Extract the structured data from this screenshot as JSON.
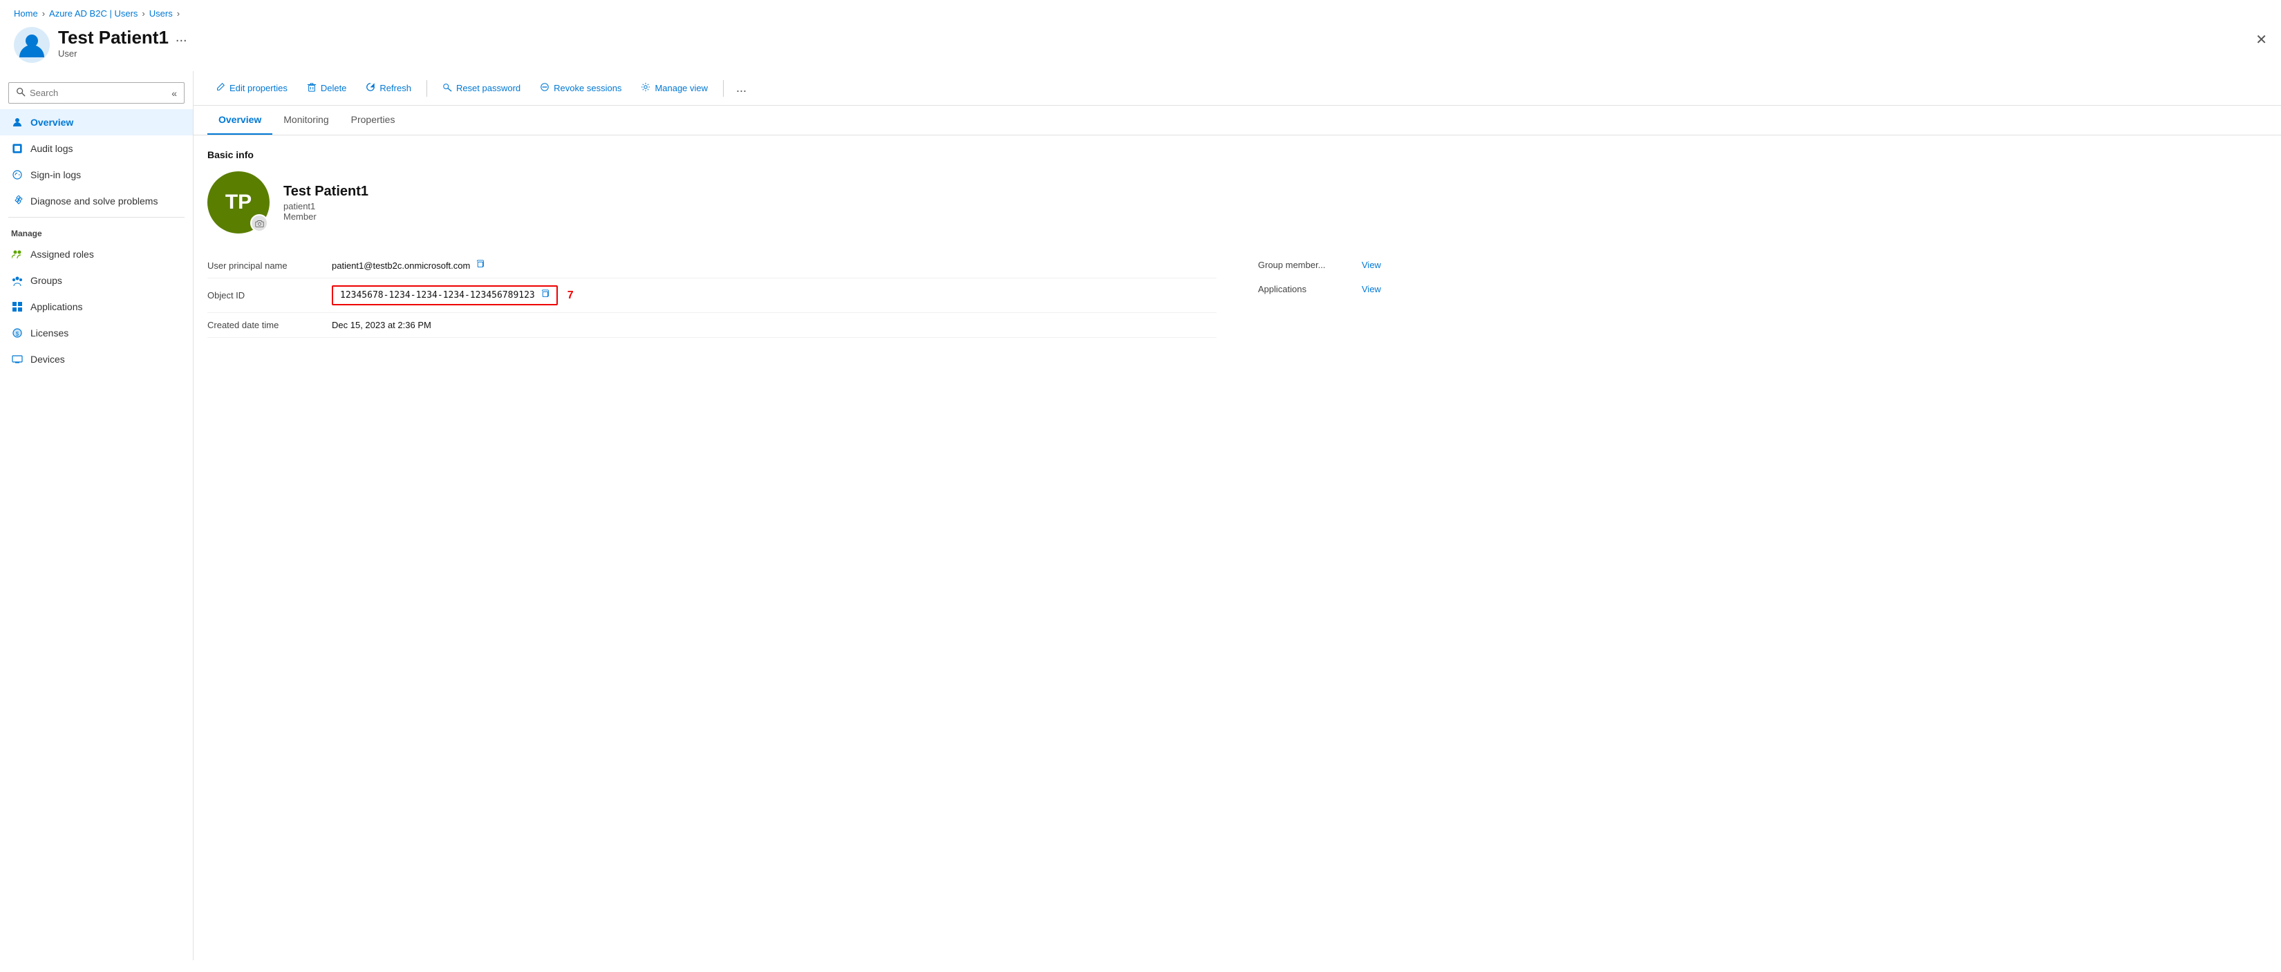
{
  "breadcrumb": {
    "items": [
      "Home",
      "Azure AD B2C | Users",
      "Users"
    ]
  },
  "header": {
    "title": "Test Patient1",
    "subtitle": "User",
    "avatar_initials": "TP",
    "ellipsis": "...",
    "close_label": "✕"
  },
  "sidebar": {
    "search_placeholder": "Search",
    "collapse_label": "«",
    "items": [
      {
        "id": "overview",
        "label": "Overview",
        "icon": "user-icon",
        "active": true
      },
      {
        "id": "audit-logs",
        "label": "Audit logs",
        "icon": "log-icon",
        "active": false
      },
      {
        "id": "sign-in-logs",
        "label": "Sign-in logs",
        "icon": "signin-icon",
        "active": false
      },
      {
        "id": "diagnose",
        "label": "Diagnose and solve problems",
        "icon": "wrench-icon",
        "active": false
      }
    ],
    "manage_label": "Manage",
    "manage_items": [
      {
        "id": "assigned-roles",
        "label": "Assigned roles",
        "icon": "roles-icon"
      },
      {
        "id": "groups",
        "label": "Groups",
        "icon": "groups-icon"
      },
      {
        "id": "applications",
        "label": "Applications",
        "icon": "apps-icon"
      },
      {
        "id": "licenses",
        "label": "Licenses",
        "icon": "licenses-icon"
      },
      {
        "id": "devices",
        "label": "Devices",
        "icon": "devices-icon"
      }
    ]
  },
  "toolbar": {
    "edit_label": "Edit properties",
    "delete_label": "Delete",
    "refresh_label": "Refresh",
    "reset_password_label": "Reset password",
    "revoke_sessions_label": "Revoke sessions",
    "manage_view_label": "Manage view",
    "ellipsis": "..."
  },
  "tabs": [
    {
      "id": "overview",
      "label": "Overview",
      "active": true
    },
    {
      "id": "monitoring",
      "label": "Monitoring",
      "active": false
    },
    {
      "id": "properties",
      "label": "Properties",
      "active": false
    }
  ],
  "content": {
    "basic_info_label": "Basic info",
    "user": {
      "name": "Test Patient1",
      "username": "patient1",
      "role": "Member",
      "avatar_initials": "TP"
    },
    "fields": [
      {
        "label": "User principal name",
        "value": "patient1@testb2c.onmicrosoft.com",
        "copyable": true,
        "highlighted": false
      },
      {
        "label": "Object ID",
        "value": "12345678-1234-1234-1234-123456789123",
        "copyable": true,
        "highlighted": true,
        "badge": "7"
      },
      {
        "label": "Created date time",
        "value": "Dec 15, 2023 at 2:36 PM",
        "copyable": false,
        "highlighted": false
      }
    ],
    "right_fields": [
      {
        "label": "Group member...",
        "link": "View"
      },
      {
        "label": "Applications",
        "link": "View"
      }
    ]
  }
}
